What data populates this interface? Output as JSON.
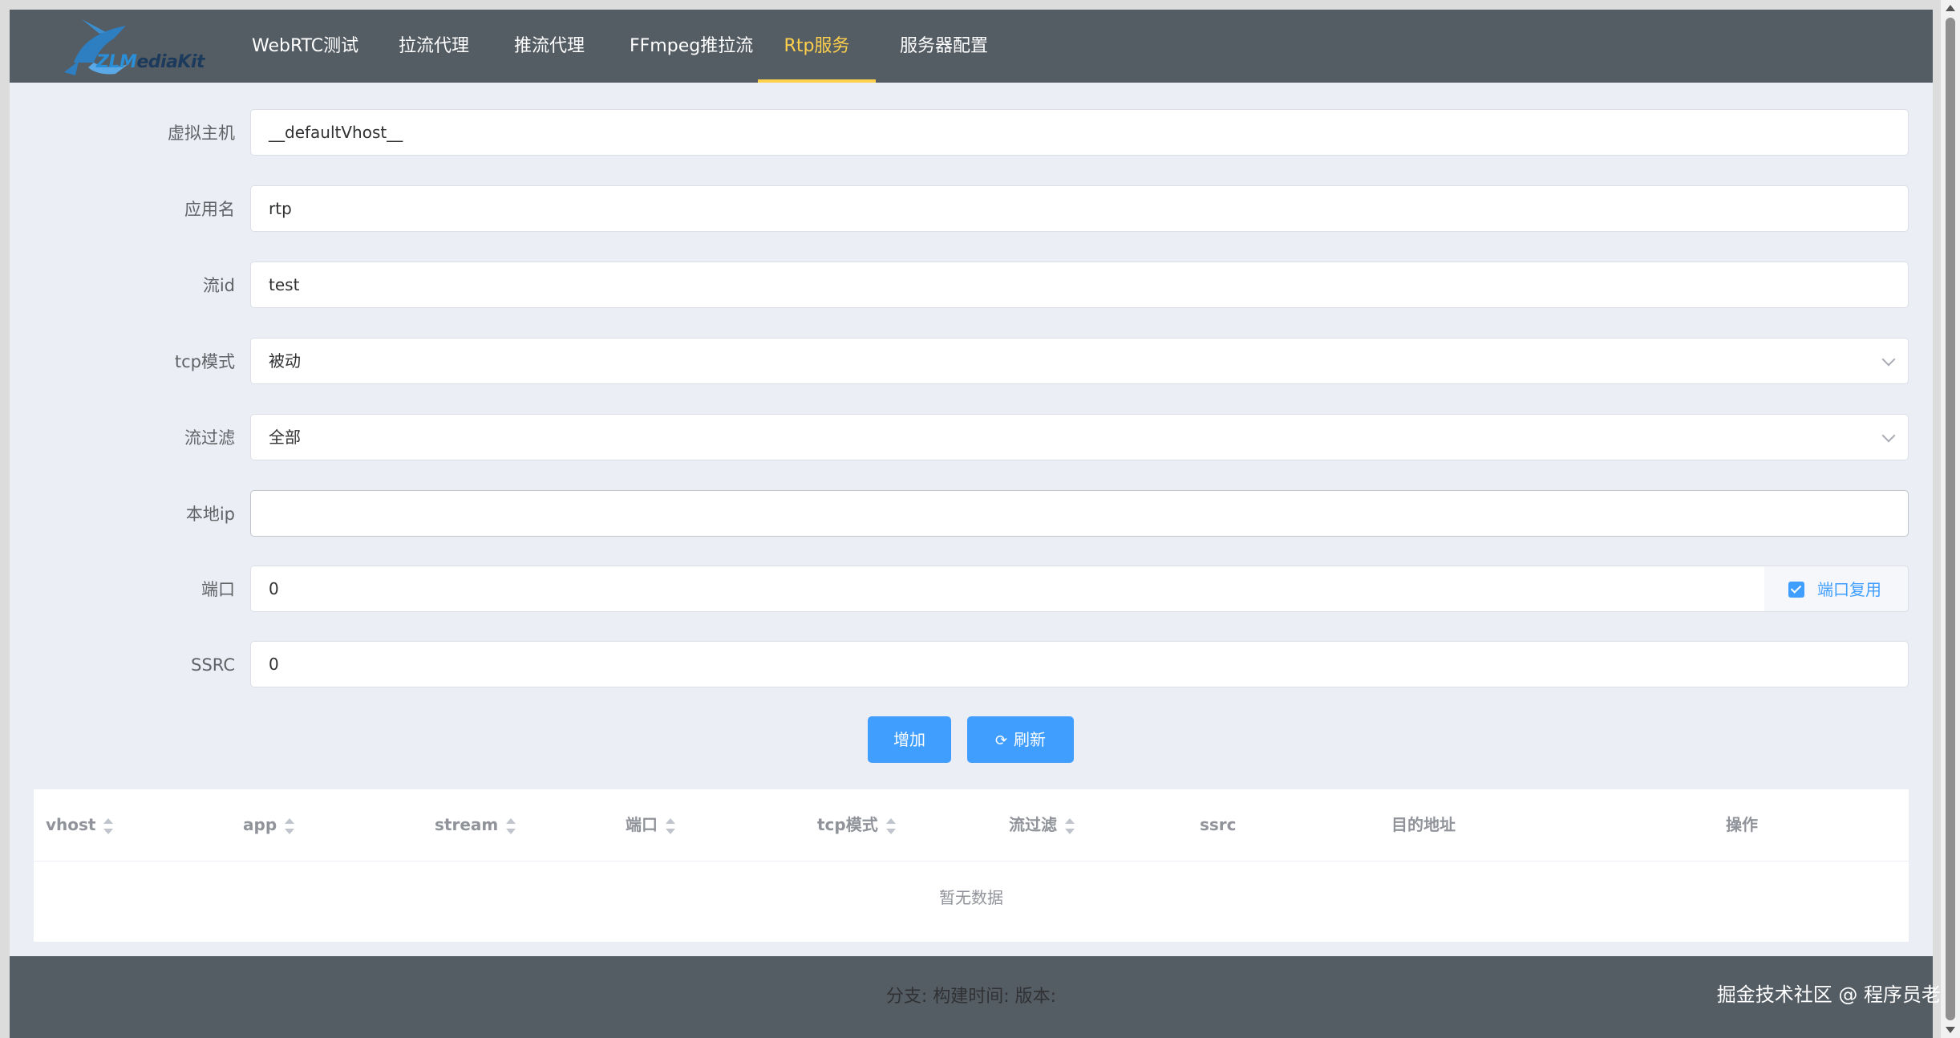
{
  "logo": {
    "text_zl": "ZLM",
    "text_rest": "ediaKit"
  },
  "nav": {
    "items": [
      {
        "label": "WebRTC测试"
      },
      {
        "label": "拉流代理"
      },
      {
        "label": "推流代理"
      },
      {
        "label": "FFmpeg推拉流"
      },
      {
        "label": "Rtp服务"
      },
      {
        "label": "服务器配置"
      }
    ],
    "active": "Rtp服务"
  },
  "form": {
    "vhost": {
      "label": "虚拟主机",
      "value": "__defaultVhost__"
    },
    "app": {
      "label": "应用名",
      "value": "rtp"
    },
    "stream": {
      "label": "流id",
      "value": "test"
    },
    "tcp_mode": {
      "label": "tcp模式",
      "value": "被动"
    },
    "filter": {
      "label": "流过滤",
      "value": "全部"
    },
    "local_ip": {
      "label": "本地ip",
      "value": ""
    },
    "port": {
      "label": "端口",
      "value": "0",
      "reuse_label": "端口复用"
    },
    "ssrc": {
      "label": "SSRC",
      "value": "0"
    }
  },
  "buttons": {
    "add": "增加",
    "refresh": "刷新"
  },
  "table": {
    "columns": [
      "vhost",
      "app",
      "stream",
      "端口",
      "tcp模式",
      "流过滤",
      "ssrc",
      "目的地址",
      "操作"
    ],
    "empty_text": "暂无数据"
  },
  "footer": {
    "text": "分支:   构建时间:  版本:"
  },
  "credit": "掘金技术社区 @ 程序员老赵",
  "colors": {
    "accent": "#409eff",
    "nav_bg": "#545c64",
    "nav_active": "#ffd04b",
    "page_bg": "#ebeef4"
  }
}
